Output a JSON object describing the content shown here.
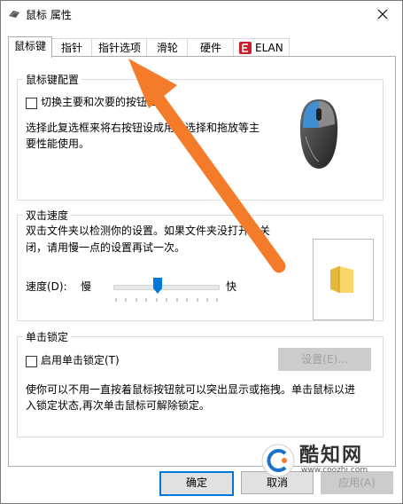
{
  "window": {
    "title": "鼠标 属性"
  },
  "tabs": [
    {
      "label": "鼠标键"
    },
    {
      "label": "指针"
    },
    {
      "label": "指针选项"
    },
    {
      "label": "滑轮"
    },
    {
      "label": "硬件"
    },
    {
      "label": "ELAN"
    }
  ],
  "button_config": {
    "group_label": "鼠标键配置",
    "switch_label": "切换主要和次要的按钮(S)",
    "description": "选择此复选框来将右按钮设成用于选择和拖放等主要性能使用。"
  },
  "double_click": {
    "group_label": "双击速度",
    "description_line1": "双击文件夹以检测你的设置。如果文件夹没打开或关",
    "description_line2": "闭，请用慢一点的设置再试一次。",
    "speed_label": "速度(D):",
    "slow_label": "慢",
    "fast_label": "快",
    "speed_value": 0.42
  },
  "click_lock": {
    "group_label": "单击锁定",
    "enable_label": "启用单击锁定(T)",
    "settings_button": "设置(E)...",
    "description_line1": "使你可以不用一直按着鼠标按钮就可以突出显示或拖拽。单击鼠标以进",
    "description_line2": "入锁定状态,再次单击鼠标可解除锁定。"
  },
  "footer": {
    "ok": "确定",
    "cancel": "取消",
    "apply": "应用(A)"
  },
  "watermark": {
    "name": "酷知网",
    "url": "www.coozhi.com"
  },
  "colors": {
    "accent": "#0078d7",
    "arrow": "#f47b2a",
    "mouse_blue": "#3f8fd2"
  }
}
